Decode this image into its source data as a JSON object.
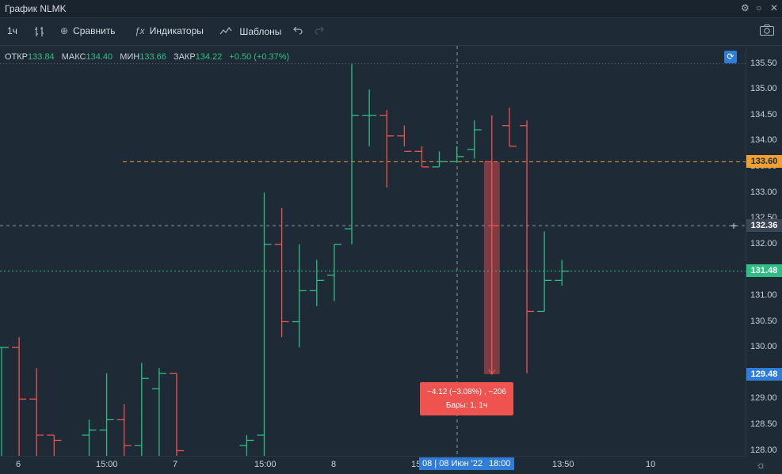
{
  "window": {
    "title": "График NLMK",
    "gear": "⚙",
    "minimize": "○",
    "close": "✕"
  },
  "toolbar": {
    "interval": "1ч",
    "bar_style_icon": "bars-icon",
    "compare_label": "Сравнить",
    "indicators_label": "Индикаторы",
    "templates_label": "Шаблоны",
    "undo_icon": "undo-icon",
    "redo_icon": "redo-icon",
    "camera_icon": "camera-icon"
  },
  "ohlc": {
    "open_label": "ОТКР",
    "open": "133.84",
    "high_label": "МАКС",
    "high": "134.40",
    "low_label": "МИН",
    "low": "133.66",
    "close_label": "ЗАКР",
    "close": "134.22",
    "change": "+0.50 (+0.37%)"
  },
  "colors": {
    "up": "#2ebd85",
    "down": "#ef5350",
    "accent": "#2f7dd8",
    "level": "#f0a030"
  },
  "price_axis": {
    "ticks": [
      "135.50",
      "135.00",
      "134.50",
      "134.00",
      "133.50",
      "133.00",
      "132.50",
      "132.00",
      "131.50",
      "131.00",
      "130.50",
      "130.00",
      "129.50",
      "129.00",
      "128.50",
      "128.00"
    ],
    "level_label": "133.60",
    "crosshair_label": "132.36",
    "last_label": "131.48",
    "measure_low_label": "129.48"
  },
  "time_axis": {
    "ticks": [
      "6",
      "15:00",
      "7",
      "15:00",
      "8",
      "15",
      "13:50",
      "10"
    ],
    "cursor_label": "08 | 08 Июн '22",
    "cursor_time": "18:00"
  },
  "measure_tooltip": {
    "line1": "−4.12 (−3.08%) , −206",
    "line2": "Бары: 1, 1ч"
  },
  "chart_data": {
    "type": "ohlc",
    "ylim": [
      127.9,
      135.85
    ],
    "bars": [
      {
        "x": 0,
        "o": 130.0,
        "h": 130.0,
        "l": 127.9,
        "c": 130.0
      },
      {
        "x": 1,
        "o": 130.0,
        "h": 130.2,
        "l": 127.9,
        "c": 129.0
      },
      {
        "x": 2,
        "o": 129.0,
        "h": 129.6,
        "l": 127.9,
        "c": 128.3
      },
      {
        "x": 3,
        "o": 128.3,
        "h": 128.3,
        "l": 127.9,
        "c": 128.2
      },
      {
        "x": 5,
        "o": 128.3,
        "h": 128.6,
        "l": 127.9,
        "c": 128.4
      },
      {
        "x": 6,
        "o": 128.4,
        "h": 129.5,
        "l": 127.9,
        "c": 128.6
      },
      {
        "x": 7,
        "o": 128.6,
        "h": 128.9,
        "l": 127.9,
        "c": 128.1
      },
      {
        "x": 8,
        "o": 128.1,
        "h": 129.7,
        "l": 127.9,
        "c": 129.4
      },
      {
        "x": 9,
        "o": 129.2,
        "h": 129.6,
        "l": 127.9,
        "c": 129.5
      },
      {
        "x": 10,
        "o": 129.5,
        "h": 129.5,
        "l": 127.9,
        "c": 128.0
      },
      {
        "x": 14,
        "o": 128.1,
        "h": 128.3,
        "l": 127.9,
        "c": 128.2
      },
      {
        "x": 15,
        "o": 128.3,
        "h": 133.0,
        "l": 127.9,
        "c": 132.0
      },
      {
        "x": 16,
        "o": 132.0,
        "h": 132.7,
        "l": 130.2,
        "c": 130.5
      },
      {
        "x": 17,
        "o": 130.5,
        "h": 132.0,
        "l": 130.0,
        "c": 131.1
      },
      {
        "x": 18,
        "o": 131.1,
        "h": 131.7,
        "l": 130.8,
        "c": 131.3
      },
      {
        "x": 19,
        "o": 131.4,
        "h": 132.0,
        "l": 130.9,
        "c": 132.0
      },
      {
        "x": 20,
        "o": 132.3,
        "h": 135.5,
        "l": 132.0,
        "c": 134.5
      },
      {
        "x": 21,
        "o": 134.5,
        "h": 135.0,
        "l": 133.9,
        "c": 134.5
      },
      {
        "x": 22,
        "o": 134.5,
        "h": 134.6,
        "l": 133.1,
        "c": 134.1
      },
      {
        "x": 23,
        "o": 134.1,
        "h": 134.3,
        "l": 133.9,
        "c": 133.8
      },
      {
        "x": 24,
        "o": 133.8,
        "h": 133.9,
        "l": 133.5,
        "c": 133.5
      },
      {
        "x": 25,
        "o": 133.5,
        "h": 133.8,
        "l": 133.5,
        "c": 133.6
      },
      {
        "x": 26,
        "o": 133.6,
        "h": 133.9,
        "l": 133.6,
        "c": 133.7
      },
      {
        "x": 27,
        "o": 133.84,
        "h": 134.4,
        "l": 133.66,
        "c": 134.22
      },
      {
        "x": 28,
        "o": 133.6,
        "h": 134.5,
        "l": 129.48,
        "c": 132.36
      },
      {
        "x": 29,
        "o": 134.3,
        "h": 134.65,
        "l": 133.9,
        "c": 133.9
      },
      {
        "x": 30,
        "o": 134.3,
        "h": 134.4,
        "l": 129.5,
        "c": 130.7
      },
      {
        "x": 31,
        "o": 130.7,
        "h": 132.25,
        "l": 130.7,
        "c": 131.3
      },
      {
        "x": 32,
        "o": 131.3,
        "h": 131.7,
        "l": 131.2,
        "c": 131.48
      }
    ]
  }
}
